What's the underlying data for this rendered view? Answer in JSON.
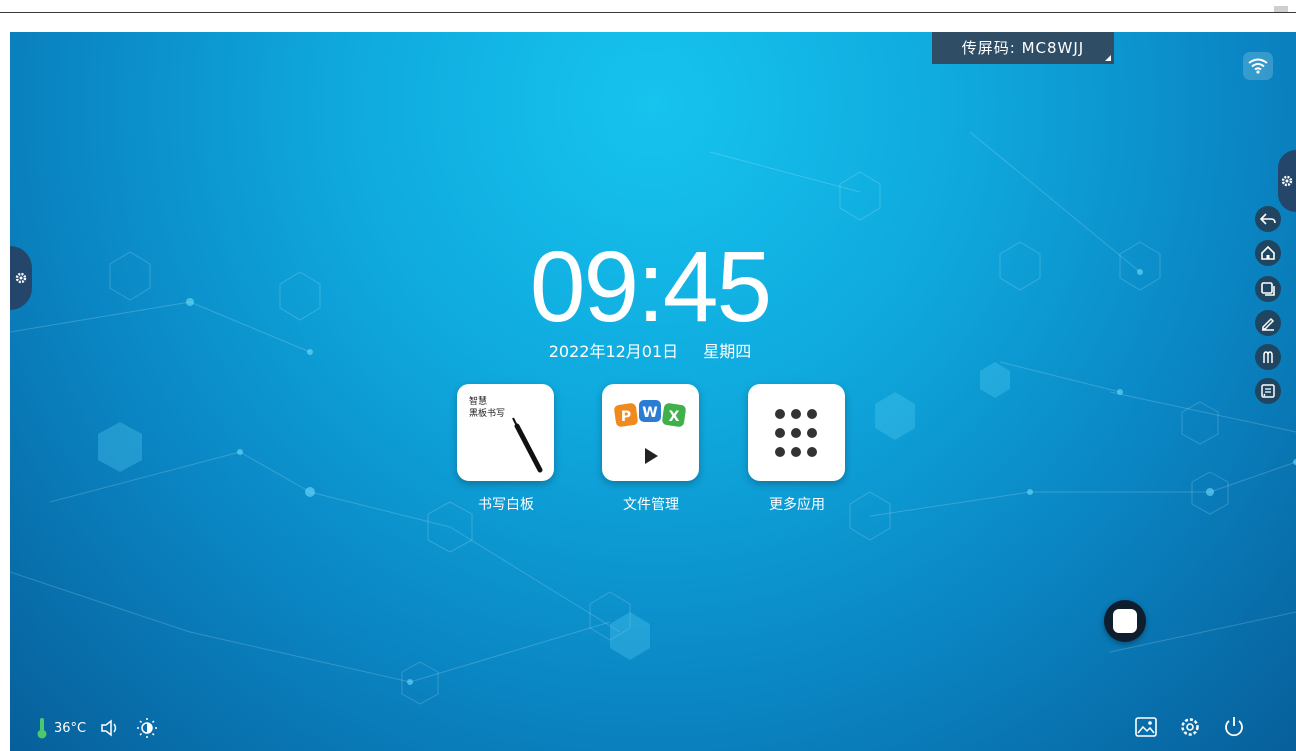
{
  "cast": {
    "code_text": "传屏码: MC8WJJ"
  },
  "clock": {
    "time": "09:45",
    "date": "2022年12月01日",
    "weekday": "星期四"
  },
  "apps": [
    {
      "label": "书写白板",
      "icon": "whiteboard-icon",
      "icon_text_line1": "智慧",
      "icon_text_line2": "黑板书写"
    },
    {
      "label": "文件管理",
      "icon": "file-manager-icon",
      "letters": [
        "P",
        "W",
        "X"
      ]
    },
    {
      "label": "更多应用",
      "icon": "more-apps-grid-icon"
    }
  ],
  "status": {
    "temperature": "36°C"
  },
  "colors": {
    "accent_dark": "#24466a",
    "cast_bar": "#2f4e66",
    "ppt_orange": "#f08a1c",
    "word_blue": "#2b7cd3",
    "excel_green": "#3fb04a"
  }
}
